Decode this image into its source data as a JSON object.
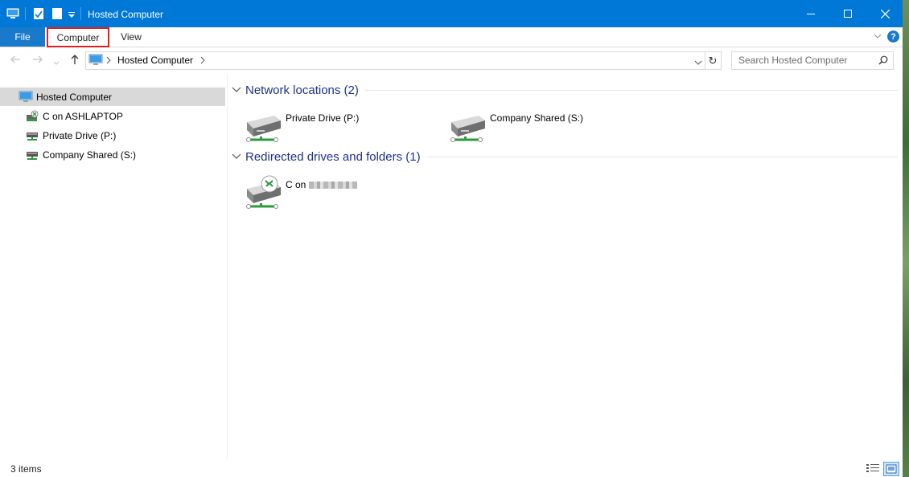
{
  "window": {
    "title": "Hosted Computer"
  },
  "ribbon": {
    "file_label": "File",
    "computer_label": "Computer",
    "view_label": "View",
    "help_label": "?"
  },
  "address": {
    "path": "Hosted Computer",
    "search_placeholder": "Search Hosted Computer"
  },
  "nav": {
    "items": [
      {
        "label": "Hosted Computer",
        "icon": "computer-icon"
      },
      {
        "label": "C on ASHLAPTOP",
        "icon": "redirected-drive-icon"
      },
      {
        "label": "Private Drive (P:)",
        "icon": "network-drive-icon"
      },
      {
        "label": "Company Shared (S:)",
        "icon": "network-drive-icon"
      }
    ]
  },
  "content": {
    "groups": [
      {
        "title": "Network locations (2)",
        "items": [
          {
            "label": "Private Drive (P:)"
          },
          {
            "label": "Company Shared (S:)"
          }
        ]
      },
      {
        "title": "Redirected drives and folders (1)",
        "items": [
          {
            "label": "C on"
          }
        ]
      }
    ]
  },
  "status": {
    "count": "3 items"
  },
  "colors": {
    "titlebar": "#0078d7",
    "file_tab": "#1979ca",
    "group_title": "#1e3287",
    "highlight": "#e0201b"
  }
}
